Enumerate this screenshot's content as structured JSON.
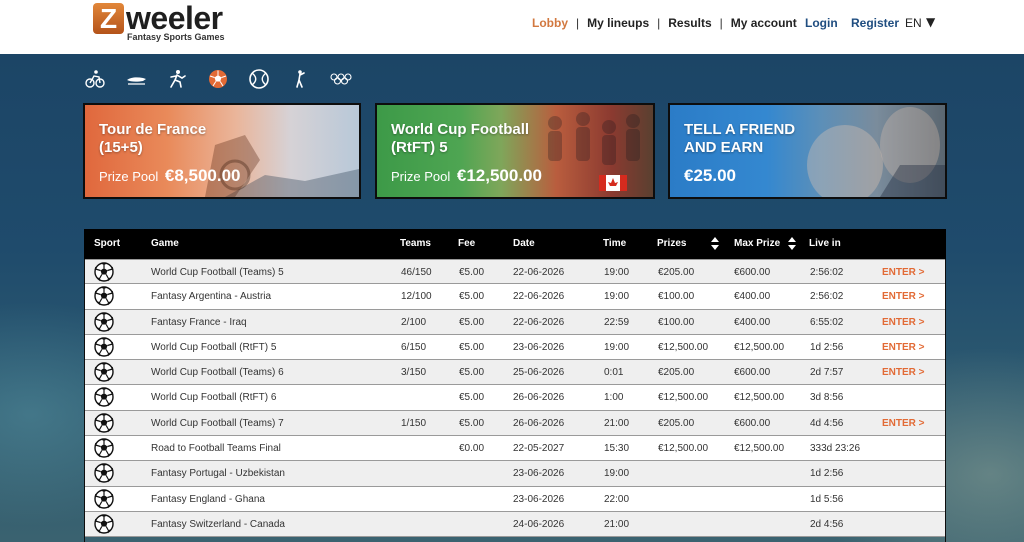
{
  "header": {
    "brand": "Zweeler",
    "brand_initial": "Z",
    "brand_rest": "weeler",
    "tagline": "Fantasy Sports Games",
    "nav": [
      "Lobby",
      "My lineups",
      "Results",
      "My account"
    ],
    "login": "Login",
    "register": "Register",
    "language": "EN",
    "language_arrow": "▼"
  },
  "sport_icons": [
    "cycling-icon",
    "speed-skating-icon",
    "athletics-icon",
    "football-icon",
    "tennis-icon",
    "golf-icon",
    "olympics-icon"
  ],
  "promos": [
    {
      "title_line1": "Tour de France",
      "title_line2": "(15+5)",
      "prize_label": "Prize Pool",
      "prize": "€8,500.00"
    },
    {
      "title_line1": "World Cup Football",
      "title_line2": "(RtFT) 5",
      "prize_label": "Prize Pool",
      "prize": "€12,500.00"
    },
    {
      "title_line1": "TELL A FRIEND",
      "title_line2": "AND EARN",
      "amount": "€25.00"
    }
  ],
  "table": {
    "headers": {
      "sport": "Sport",
      "game": "Game",
      "teams": "Teams",
      "fee": "Fee",
      "date": "Date",
      "time": "Time",
      "prizes": "Prizes",
      "max_prize": "Max Prize",
      "live_in": "Live in"
    },
    "enter_label": "ENTER >",
    "rows": [
      {
        "game": "World Cup Football (Teams) 5",
        "teams": "46/150",
        "fee": "€5.00",
        "date": "22-06-2026",
        "time": "19:00",
        "prizes": "€205.00",
        "max_prize": "€600.00",
        "live_in": "2:56:02",
        "enter": "ENTER >"
      },
      {
        "game": "Fantasy Argentina - Austria",
        "teams": "12/100",
        "fee": "€5.00",
        "date": "22-06-2026",
        "time": "19:00",
        "prizes": "€100.00",
        "max_prize": "€400.00",
        "live_in": "2:56:02",
        "enter": "ENTER >"
      },
      {
        "game": "Fantasy France - Iraq",
        "teams": "2/100",
        "fee": "€5.00",
        "date": "22-06-2026",
        "time": "22:59",
        "prizes": "€100.00",
        "max_prize": "€400.00",
        "live_in": "6:55:02",
        "enter": "ENTER >"
      },
      {
        "game": "World Cup Football (RtFT) 5",
        "teams": "6/150",
        "fee": "€5.00",
        "date": "23-06-2026",
        "time": "19:00",
        "prizes": "€12,500.00",
        "max_prize": "€12,500.00",
        "live_in": "1d 2:56",
        "enter": "ENTER >"
      },
      {
        "game": "World Cup Football (Teams) 6",
        "teams": "3/150",
        "fee": "€5.00",
        "date": "25-06-2026",
        "time": "0:01",
        "prizes": "€205.00",
        "max_prize": "€600.00",
        "live_in": "2d 7:57",
        "enter": "ENTER >"
      },
      {
        "game": "World Cup Football (RtFT) 6",
        "teams": "",
        "fee": "€5.00",
        "date": "26-06-2026",
        "time": "1:00",
        "prizes": "€12,500.00",
        "max_prize": "€12,500.00",
        "live_in": "3d 8:56",
        "enter": ""
      },
      {
        "game": "World Cup Football (Teams) 7",
        "teams": "1/150",
        "fee": "€5.00",
        "date": "26-06-2026",
        "time": "21:00",
        "prizes": "€205.00",
        "max_prize": "€600.00",
        "live_in": "4d 4:56",
        "enter": "ENTER >"
      },
      {
        "game": "Road to Football Teams Final",
        "teams": "",
        "fee": "€0.00",
        "date": "22-05-2027",
        "time": "15:30",
        "prizes": "€12,500.00",
        "max_prize": "€12,500.00",
        "live_in": "333d 23:26",
        "enter": ""
      },
      {
        "game": "Fantasy Portugal - Uzbekistan",
        "teams": "",
        "fee": "",
        "date": "23-06-2026",
        "time": "19:00",
        "prizes": "",
        "max_prize": "",
        "live_in": "1d 2:56",
        "enter": ""
      },
      {
        "game": "Fantasy England - Ghana",
        "teams": "",
        "fee": "",
        "date": "23-06-2026",
        "time": "22:00",
        "prizes": "",
        "max_prize": "",
        "live_in": "1d 5:56",
        "enter": ""
      },
      {
        "game": "Fantasy Switzerland - Canada",
        "teams": "",
        "fee": "",
        "date": "24-06-2026",
        "time": "21:00",
        "prizes": "",
        "max_prize": "",
        "live_in": "2d 4:56",
        "enter": ""
      }
    ]
  },
  "colors": {
    "accent_orange": "#e26a35",
    "nav_active": "#d2783f",
    "link_blue": "#1f4d80",
    "table_header": "#000000"
  }
}
